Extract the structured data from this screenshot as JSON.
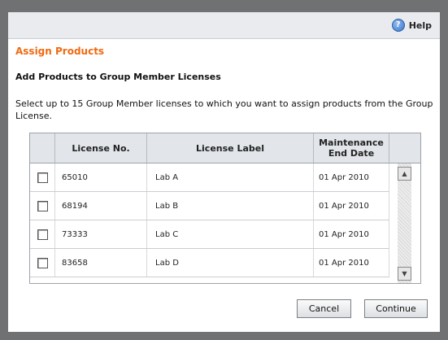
{
  "topbar": {
    "help_label": "Help",
    "help_icon": "help-icon"
  },
  "page": {
    "title": "Assign Products",
    "subtitle": "Add Products to Group Member Licenses",
    "instructions": "Select up to 15 Group Member licenses to which you want to assign products from the Group License."
  },
  "table": {
    "headers": {
      "license_no": "License No.",
      "license_label": "License Label",
      "maintenance_end": "Maintenance End Date"
    },
    "rows": [
      {
        "license_no": "65010",
        "label": "Lab A",
        "date": "01 Apr 2010",
        "checked": false
      },
      {
        "license_no": "68194",
        "label": "Lab B",
        "date": "01 Apr 2010",
        "checked": false
      },
      {
        "license_no": "73333",
        "label": "Lab C",
        "date": "01 Apr 2010",
        "checked": false
      },
      {
        "license_no": "83658",
        "label": "Lab D",
        "date": "01 Apr 2010",
        "checked": false
      }
    ]
  },
  "buttons": {
    "cancel": "Cancel",
    "continue": "Continue"
  },
  "colors": {
    "accent": "#f06a10",
    "header_bg": "#e2e5e9",
    "backdrop": "#6f7173"
  }
}
